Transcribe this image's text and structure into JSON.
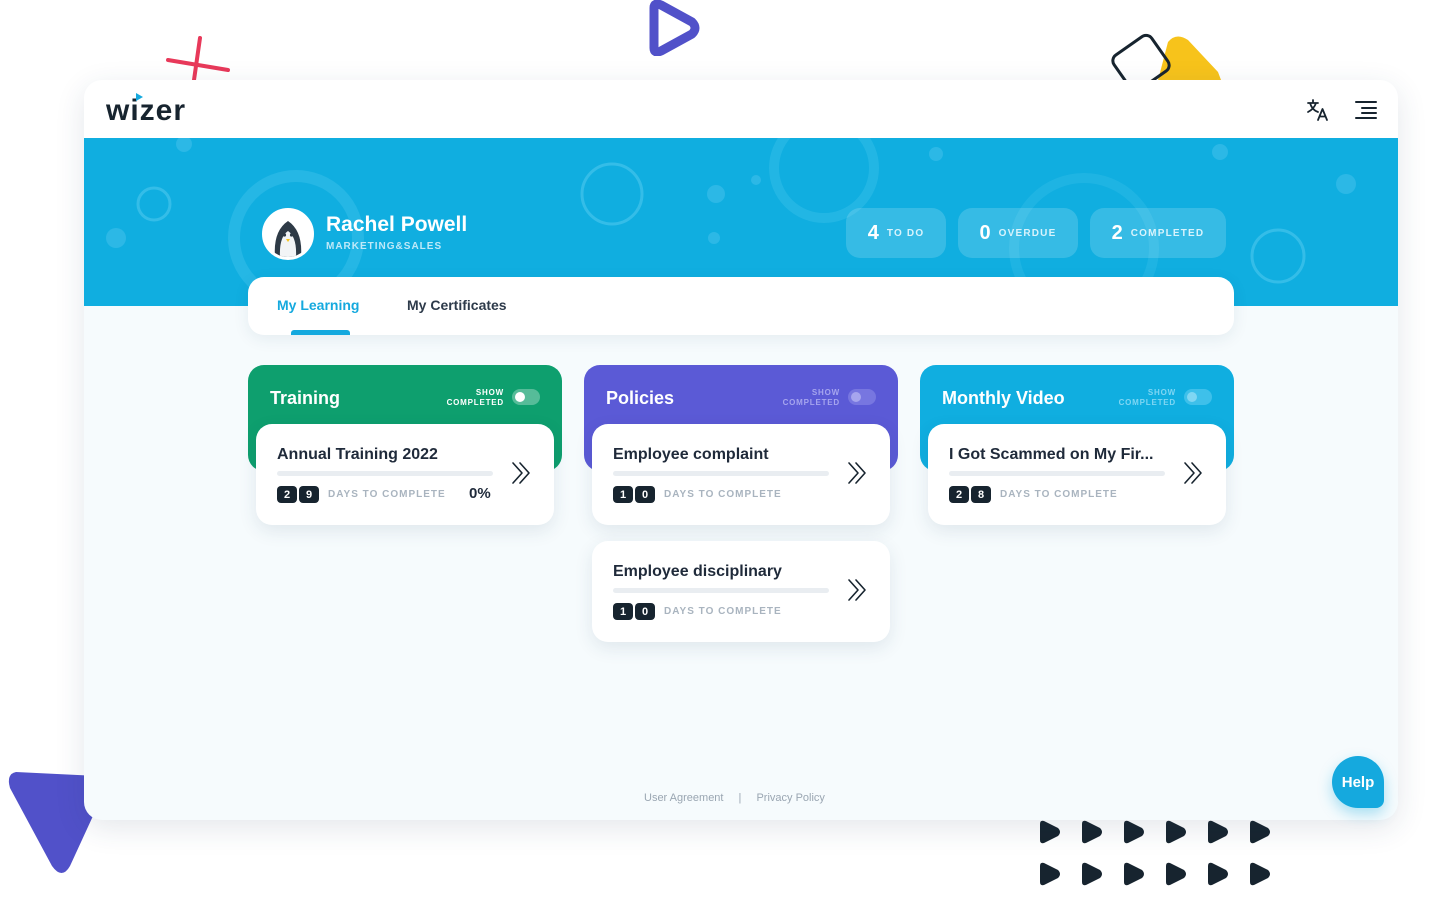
{
  "brand": {
    "logo_text": "wizer"
  },
  "header": {
    "translate_icon": "translate-icon",
    "menu_icon": "menu-lines-icon"
  },
  "user": {
    "name": "Rachel Powell",
    "department": "MARKETING&SALES"
  },
  "stats": [
    {
      "value": "4",
      "label": "TO DO"
    },
    {
      "value": "0",
      "label": "OVERDUE"
    },
    {
      "value": "2",
      "label": "COMPLETED"
    }
  ],
  "tabs": [
    {
      "label": "My Learning",
      "active": true
    },
    {
      "label": "My Certificates",
      "active": false
    }
  ],
  "columns": [
    {
      "title": "Training",
      "color": "#0e9f6e",
      "toggle_label_line1": "SHOW",
      "toggle_label_line2": "COMPLETED",
      "items": [
        {
          "title": "Annual Training 2022",
          "days": [
            "2",
            "9"
          ],
          "days_label": "DAYS TO COMPLETE",
          "percent": "0%",
          "progress": 0
        }
      ]
    },
    {
      "title": "Policies",
      "color": "#5b5ad6",
      "toggle_label_line1": "SHOW",
      "toggle_label_line2": "COMPLETED",
      "items": [
        {
          "title": "Employee complaint",
          "days": [
            "1",
            "0"
          ],
          "days_label": "DAYS TO COMPLETE",
          "progress": 0
        },
        {
          "title": "Employee disciplinary",
          "days": [
            "1",
            "0"
          ],
          "days_label": "DAYS TO COMPLETE",
          "progress": 0
        }
      ]
    },
    {
      "title": "Monthly Video",
      "color": "#10aee0",
      "toggle_label_line1": "SHOW",
      "toggle_label_line2": "COMPLETED",
      "items": [
        {
          "title": "I Got Scammed on My Fir...",
          "days": [
            "2",
            "8"
          ],
          "days_label": "DAYS TO COMPLETE",
          "progress": 0
        }
      ]
    }
  ],
  "footer": {
    "user_agreement": "User Agreement",
    "separator": "|",
    "privacy_policy": "Privacy Policy"
  },
  "help": {
    "label": "Help"
  },
  "colors": {
    "accent": "#15a9de",
    "hero": "#10aee0",
    "training": "#0e9f6e",
    "policies": "#5b5ad6",
    "monthly_video": "#10aee0",
    "decor_red": "#e8395a",
    "decor_purple": "#5151c9",
    "decor_yellow": "#f7c31b",
    "decor_dark": "#17242f"
  }
}
